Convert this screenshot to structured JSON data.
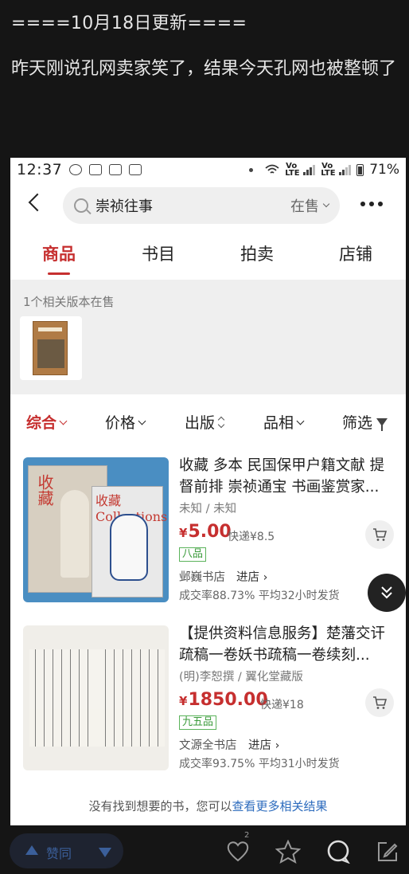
{
  "post": {
    "line1": "====10月18日更新====",
    "para": "昨天刚说孔网卖家笑了，结果今天孔网也被整顿了"
  },
  "statusbar": {
    "time": "12:37",
    "net1": "Vo LTE",
    "net2": "Vo LTE",
    "battery": "71%"
  },
  "search": {
    "query": "崇祯往事",
    "status": "在售"
  },
  "tabs": [
    "商品",
    "书目",
    "拍卖",
    "店铺"
  ],
  "related": {
    "label": "1个相关版本在售"
  },
  "sort": {
    "items": [
      "综合",
      "价格",
      "出版",
      "品相",
      "筛选"
    ]
  },
  "items": [
    {
      "title": "收藏 多本 民国保甲户籍文献 提督前排 崇祯通宝 书画鉴赏家...",
      "author": "未知 / 未知",
      "currency": "¥",
      "price": "5.00",
      "shipping": "快递¥8.5",
      "grade": "八品",
      "shop": "邺巍书店",
      "enter": "进店 ›",
      "stats": "成交率88.73%  平均32小时发货",
      "img_text1": "收藏",
      "img_text2": "收藏Collections"
    },
    {
      "title": "【提供资料信息服务】楚藩交讦疏稿一卷妖书疏稿一卷续刻...",
      "author": "(明)李恕撰 / 翼化堂藏版",
      "currency": "¥",
      "price": "1850.00",
      "shipping": "快递¥18",
      "grade": "九五品",
      "shop": "文源全书店",
      "enter": "进店 ›",
      "stats": "成交率93.75%  平均31小时发货"
    }
  ],
  "footer": {
    "hint": "没有找到想要的书，您可以",
    "link": "查看更多相关结果"
  },
  "bottombar": {
    "vote": "赞同",
    "like_count": "2"
  },
  "colors": {
    "accent": "#c62f2f",
    "link": "#2c6bbd",
    "grade": "#3a9a3a"
  }
}
